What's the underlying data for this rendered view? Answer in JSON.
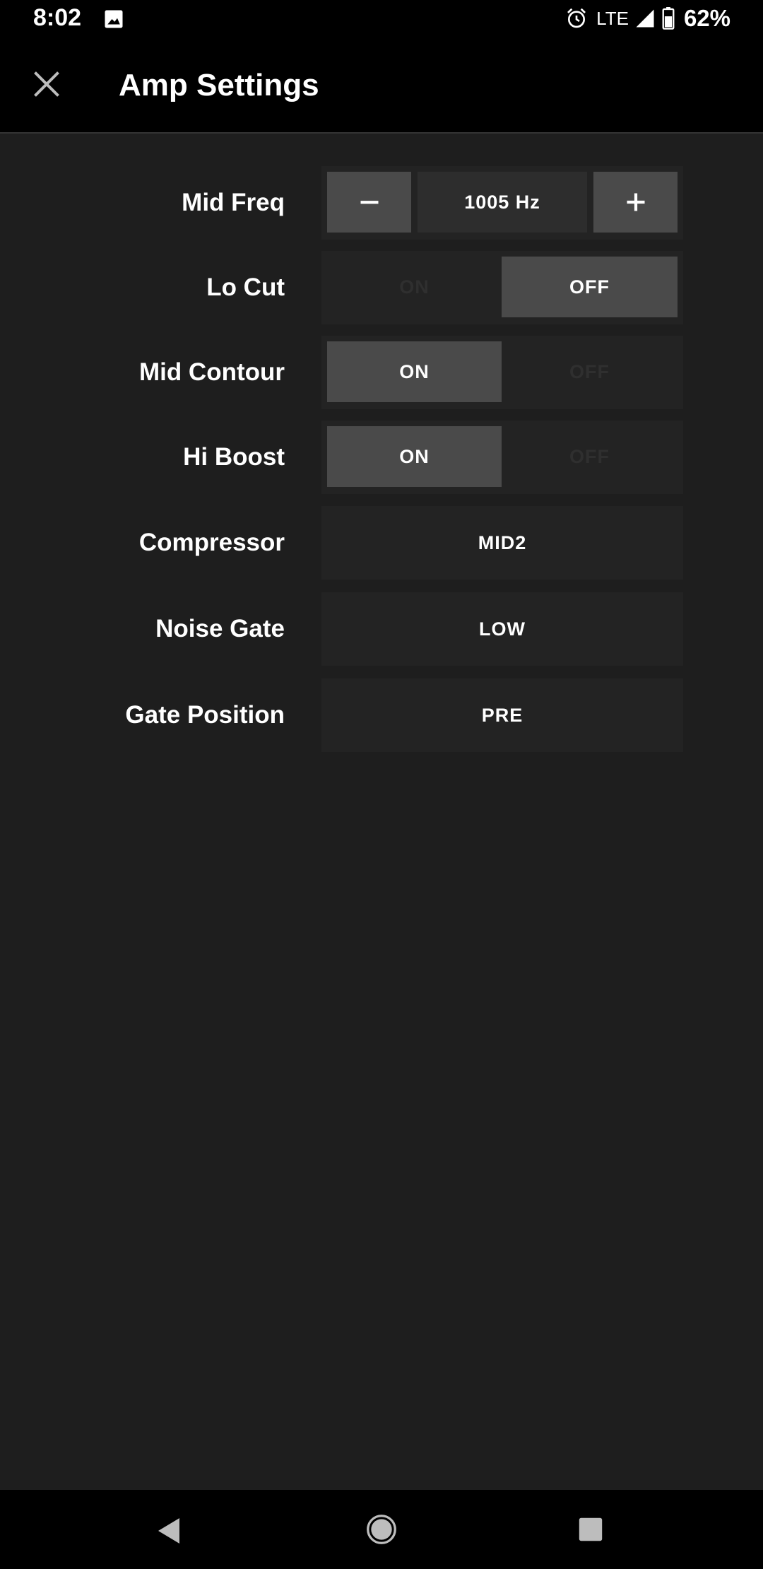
{
  "status_bar": {
    "time": "8:02",
    "network": "LTE",
    "battery": "62%",
    "icons": [
      "image-icon",
      "alarm-icon",
      "signal-icon",
      "battery-icon"
    ]
  },
  "app_bar": {
    "title": "Amp Settings",
    "close_icon": "close-icon"
  },
  "settings": {
    "mid_freq": {
      "label": "Mid Freq",
      "value": "1005 Hz",
      "minus": "−",
      "plus": "+"
    },
    "lo_cut": {
      "label": "Lo Cut",
      "on": "ON",
      "off": "OFF",
      "selected": "OFF"
    },
    "mid_contour": {
      "label": "Mid Contour",
      "on": "ON",
      "off": "OFF",
      "selected": "ON"
    },
    "hi_boost": {
      "label": "Hi Boost",
      "on": "ON",
      "off": "OFF",
      "selected": "ON"
    },
    "compressor": {
      "label": "Compressor",
      "value": "MID2"
    },
    "noise_gate": {
      "label": "Noise Gate",
      "value": "LOW"
    },
    "gate_position": {
      "label": "Gate Position",
      "value": "PRE"
    }
  },
  "nav_bar": {
    "icons": [
      "back-icon",
      "home-icon",
      "recent-apps-icon"
    ]
  },
  "colors": {
    "background": "#1e1e1e",
    "bar": "#000000",
    "control_bg": "#232323",
    "active_segment": "#4a4a4a",
    "text": "#ffffff"
  }
}
